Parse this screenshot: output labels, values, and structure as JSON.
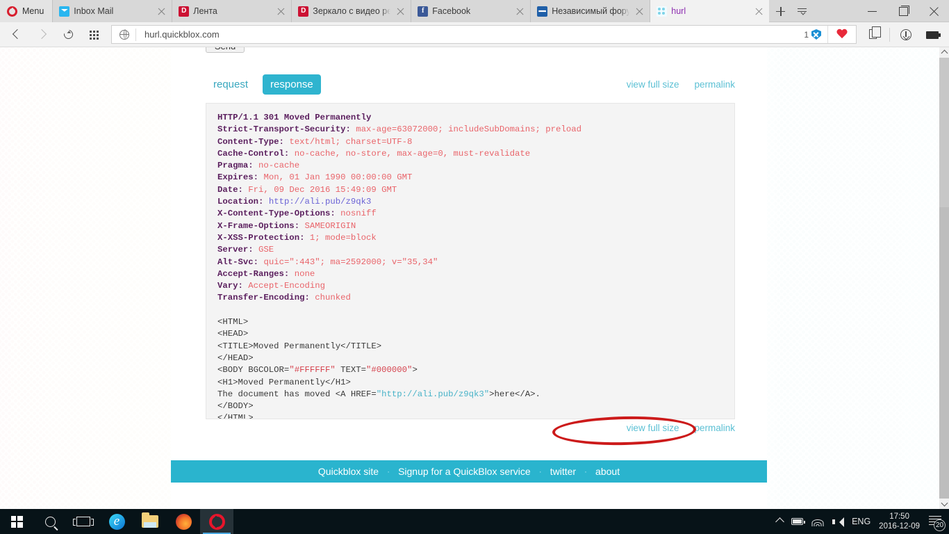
{
  "browser": {
    "menu_label": "Menu",
    "tabs": [
      {
        "title": "Inbox Mail",
        "icon": "mail-icon",
        "active": false
      },
      {
        "title": "Лента",
        "icon": "dzen-icon",
        "active": false
      },
      {
        "title": "Зеркало с видео регис",
        "icon": "dzen-icon",
        "active": false
      },
      {
        "title": "Facebook",
        "icon": "facebook-icon",
        "active": false
      },
      {
        "title": "Независимый форум п",
        "icon": "forum-icon",
        "active": false
      },
      {
        "title": "hurl",
        "icon": "hurl-icon",
        "active": true
      }
    ],
    "address": "hurl.quickblox.com",
    "blocked_count": "1",
    "window_controls": {
      "minimize": "–",
      "maximize": "□",
      "close": "✕"
    }
  },
  "page": {
    "send_button": "Send",
    "tabs": [
      {
        "label": "request",
        "selected": false
      },
      {
        "label": "response",
        "selected": true
      }
    ],
    "links": {
      "view_full_size": "view full size",
      "permalink": "permalink"
    },
    "response": {
      "status_line": "HTTP/1.1 301 Moved Permanently",
      "headers": [
        {
          "name": "Strict-Transport-Security:",
          "value": "max-age=63072000; includeSubDomains; preload",
          "kind": "value"
        },
        {
          "name": "Content-Type:",
          "value": "text/html; charset=UTF-8",
          "kind": "value"
        },
        {
          "name": "Cache-Control:",
          "value": "no-cache, no-store, max-age=0, must-revalidate",
          "kind": "value"
        },
        {
          "name": "Pragma:",
          "value": "no-cache",
          "kind": "value"
        },
        {
          "name": "Expires:",
          "value": "Mon, 01 Jan 1990 00:00:00 GMT",
          "kind": "value"
        },
        {
          "name": "Date:",
          "value": "Fri, 09 Dec 2016 15:49:09 GMT",
          "kind": "value"
        },
        {
          "name": "Location:",
          "value": "http://ali.pub/z9qk3",
          "kind": "link"
        },
        {
          "name": "X-Content-Type-Options:",
          "value": "nosniff",
          "kind": "value"
        },
        {
          "name": "X-Frame-Options:",
          "value": "SAMEORIGIN",
          "kind": "value"
        },
        {
          "name": "X-XSS-Protection:",
          "value": "1; mode=block",
          "kind": "value"
        },
        {
          "name": "Server:",
          "value": "GSE",
          "kind": "value"
        },
        {
          "name": "Alt-Svc:",
          "value": "quic=\":443\"; ma=2592000; v=\"35,34\"",
          "kind": "value"
        },
        {
          "name": "Accept-Ranges:",
          "value": "none",
          "kind": "value"
        },
        {
          "name": "Vary:",
          "value": "Accept-Encoding",
          "kind": "value"
        },
        {
          "name": "Transfer-Encoding:",
          "value": "chunked",
          "kind": "value"
        }
      ],
      "body_lines": [
        "<HTML>",
        "<HEAD>",
        "<TITLE>Moved Permanently</TITLE>",
        "</HEAD>",
        "<BODY BGCOLOR=\"#FFFFFF\" TEXT=\"#000000\">",
        "<H1>Moved Permanently</H1>",
        "The document has moved <A HREF=\"http://ali.pub/z9qk3\">here</A>.",
        "</BODY>",
        "</HTML>"
      ],
      "body_line_parts": [
        {
          "tag": "<BODY BGCOLOR=",
          "attr1": "\"#FFFFFF\"",
          "mid": " TEXT=",
          "attr2": "\"#000000\"",
          "end": ">"
        },
        {
          "pre": "The document has moved <A HREF=",
          "url": "\"http://ali.pub/z9qk3\"",
          "post": ">here</A>."
        }
      ],
      "annotation": {
        "shape": "ellipse",
        "color": "#cc1a1a",
        "encircles": "=\"http://ali.pub/z9qk3\">"
      }
    },
    "footer": {
      "links": [
        "Quickblox site",
        "Signup for a QuickBlox service",
        "twitter",
        "about"
      ],
      "separator": "·",
      "bg_color": "#2ab4ce"
    }
  },
  "taskbar": {
    "items": [
      "start-icon",
      "search-icon",
      "task-view-icon",
      "edge-icon",
      "explorer-icon",
      "firefox-icon",
      "opera-icon"
    ],
    "tray": {
      "language": "ENG",
      "time": "17:50",
      "date": "2016-12-09",
      "notification_count": "20"
    }
  },
  "colors": {
    "accent": "#2ab4ce",
    "link": "#5cc0d4",
    "header_name": "#5b1f5e",
    "header_value": "#e9646a",
    "annotation": "#cc1a1a"
  }
}
